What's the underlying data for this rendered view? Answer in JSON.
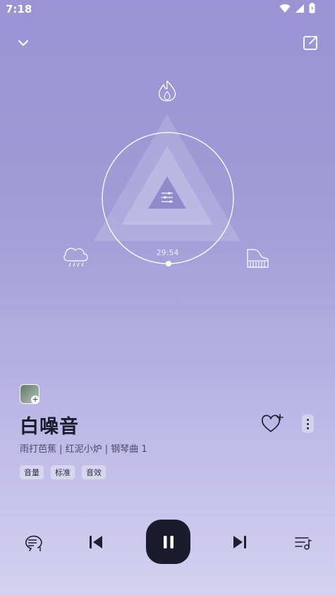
{
  "status": {
    "time": "7:18"
  },
  "player": {
    "timer": "29:54",
    "title": "白噪音",
    "subtitle": "雨打芭蕉 | 红泥小炉 | 钢琴曲 1",
    "tags": [
      "音量",
      "标准",
      "音效"
    ]
  },
  "icons": {
    "fire": "fire-icon",
    "rain": "rain-cloud-icon",
    "piano": "piano-icon",
    "mixer": "sliders-icon"
  },
  "colors": {
    "accent": "#1b1b2e",
    "background_top": "#9b93d3",
    "background_bottom": "#d5d1ef"
  }
}
